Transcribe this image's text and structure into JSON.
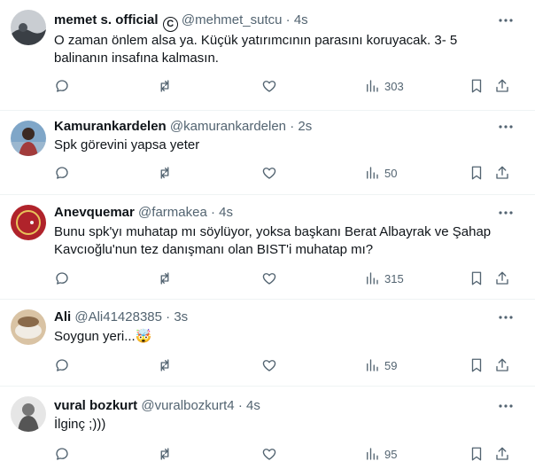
{
  "tweets": [
    {
      "name": "memet s. official",
      "verified_glyph": "C",
      "handle": "@mehmet_sutcu",
      "dot": "·",
      "time": "4s",
      "text": "O zaman önlem alsa ya. Küçük yatırımcının parasını koruyacak. 3- 5 balinanın insafına kalmasın.",
      "views": "303",
      "avatar_colors": [
        "#c9cdd2",
        "#3a3f45"
      ]
    },
    {
      "name": "Kamurankardelen",
      "handle": "@kamurankardelen",
      "dot": "·",
      "time": "2s",
      "text": "Spk görevini yapsa yeter",
      "views": "50",
      "avatar_colors": [
        "#7fa6c8",
        "#a23b3b"
      ]
    },
    {
      "name": "Anevquemar",
      "handle": "@farmakea",
      "dot": "·",
      "time": "4s",
      "text": "Bunu spk'yı muhatap mı söylüyor, yoksa başkanı Berat Albayrak ve Şahap Kavcıoğlu'nun tez danışmanı olan BIST'i muhatap mı?",
      "views": "315",
      "avatar_colors": [
        "#b0232b",
        "#e8c35a"
      ]
    },
    {
      "name": "Ali",
      "handle": "@Ali41428385",
      "dot": "·",
      "time": "3s",
      "text": "Soygun yeri...🤯",
      "views": "59",
      "avatar_colors": [
        "#d9c3a4",
        "#8a6a4a"
      ]
    },
    {
      "name": "vural bozkurt",
      "handle": "@vuralbozkurt4",
      "dot": "·",
      "time": "4s",
      "text": "İlginç ;)))",
      "views": "95",
      "avatar_colors": [
        "#e6e6e6",
        "#555555"
      ]
    }
  ]
}
